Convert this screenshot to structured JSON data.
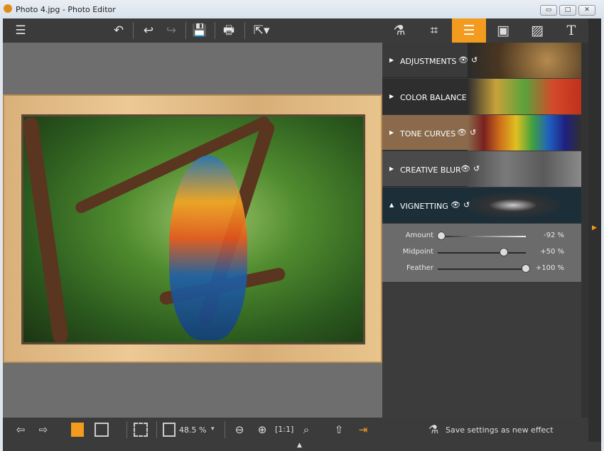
{
  "window": {
    "title": "Photo 4.jpg - Photo Editor",
    "minimize": "▭",
    "maximize": "□",
    "close": "✕"
  },
  "toolbar": {
    "menu": "☰",
    "rotate": "↶",
    "undo": "↩",
    "redo": "↪",
    "save": "💾",
    "print": "🖶",
    "export": "⇱▾"
  },
  "tabs": [
    {
      "icon": "flask-icon",
      "glyph": "⚗"
    },
    {
      "icon": "crop-icon",
      "glyph": "⌗"
    },
    {
      "icon": "sliders-icon",
      "glyph": "☰",
      "active": true
    },
    {
      "icon": "frame-icon",
      "glyph": "▣"
    },
    {
      "icon": "texture-icon",
      "glyph": "▨"
    },
    {
      "icon": "text-icon",
      "glyph": "T"
    }
  ],
  "panel": {
    "sections": [
      {
        "label": "ADJUSTMENTS",
        "arrow": "▶"
      },
      {
        "label": "COLOR BALANCE",
        "arrow": "▶"
      },
      {
        "label": "TONE CURVES",
        "arrow": "▶"
      },
      {
        "label": "CREATIVE BLUR",
        "arrow": "▶"
      },
      {
        "label": "VIGNETTING",
        "arrow": "▲",
        "expanded": true
      }
    ],
    "eye": "👁",
    "reset": "↺",
    "sliders": [
      {
        "name": "Amount",
        "value": "-92 %",
        "level": -92
      },
      {
        "name": "Midpoint",
        "value": "+50 %",
        "level": 50
      },
      {
        "name": "Feather",
        "value": "+100 %",
        "level": 100
      }
    ]
  },
  "bottom": {
    "prev": "⇦",
    "next": "⇨",
    "zoom": "48.5 %",
    "zoom_arrow": "▾",
    "save_effect": "Save settings as new effect",
    "collapse": "▲"
  },
  "colors": {
    "accent": "#f29b1e",
    "toolbar": "#3b3b3b"
  }
}
